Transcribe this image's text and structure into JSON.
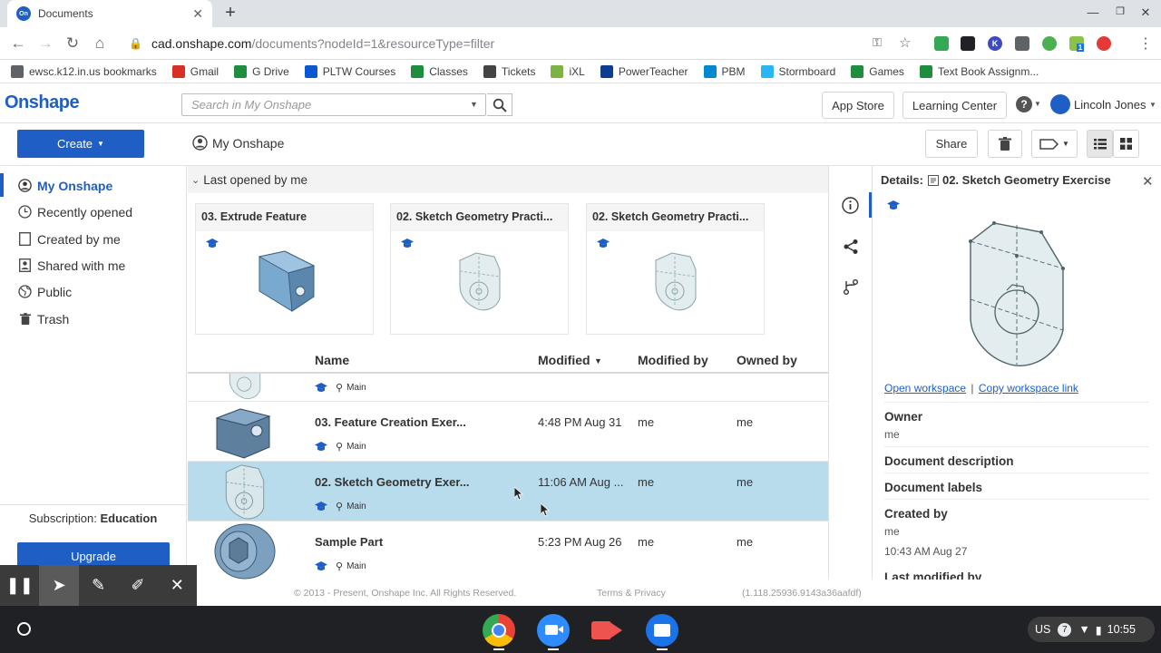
{
  "browser": {
    "tab_title": "Documents",
    "favicon_text": "On",
    "url_host": "cad.onshape.com",
    "url_path": "/documents?nodeId=1&resourceType=filter",
    "ext_badge": "1"
  },
  "bookmarks": [
    {
      "label": "ewsc.k12.in.us bookmarks",
      "color": "#5f6368"
    },
    {
      "label": "Gmail",
      "color": "#d93025"
    },
    {
      "label": "G Drive",
      "color": "#1e8e3e"
    },
    {
      "label": "PLTW Courses",
      "color": "#0b57d0"
    },
    {
      "label": "Classes",
      "color": "#1e8e3e"
    },
    {
      "label": "Tickets",
      "color": "#444444"
    },
    {
      "label": "iXL",
      "color": "#7cb342"
    },
    {
      "label": "PowerTeacher",
      "color": "#0b3d91"
    },
    {
      "label": "PBM",
      "color": "#0288d1"
    },
    {
      "label": "Stormboard",
      "color": "#29b6f6"
    },
    {
      "label": "Games",
      "color": "#1e8e3e"
    },
    {
      "label": "Text Book Assignm...",
      "color": "#1e8e3e"
    }
  ],
  "header": {
    "logo": "Onshape",
    "search_placeholder": "Search in My Onshape",
    "app_store": "App Store",
    "learning_center": "Learning Center",
    "user_name": "Lincoln Jones"
  },
  "toolbar": {
    "create": "Create",
    "title": "My Onshape",
    "share": "Share"
  },
  "sidebar": {
    "items": [
      {
        "label": "My Onshape"
      },
      {
        "label": "Recently opened"
      },
      {
        "label": "Created by me"
      },
      {
        "label": "Shared with me"
      },
      {
        "label": "Public"
      },
      {
        "label": "Trash"
      }
    ],
    "subscription_label": "Subscription:",
    "subscription_value": "Education",
    "upgrade": "Upgrade"
  },
  "recent": {
    "header": "Last opened by me",
    "cards": [
      {
        "title": "03. Extrude Feature"
      },
      {
        "title": "02. Sketch Geometry Practi..."
      },
      {
        "title": "02. Sketch Geometry Practi..."
      }
    ]
  },
  "table": {
    "headers": {
      "name": "Name",
      "modified": "Modified",
      "modified_by": "Modified by",
      "owned_by": "Owned by"
    },
    "branch_label": "Main",
    "rows": [
      {
        "name": "03. Feature Creation Exer...",
        "modified": "4:48 PM Aug 31",
        "modified_by": "me",
        "owned_by": "me"
      },
      {
        "name": "02. Sketch Geometry Exer...",
        "modified": "11:06 AM Aug ...",
        "modified_by": "me",
        "owned_by": "me"
      },
      {
        "name": "Sample Part",
        "modified": "5:23 PM Aug 26",
        "modified_by": "me",
        "owned_by": "me"
      }
    ]
  },
  "details": {
    "prefix": "Details:",
    "title": "02. Sketch Geometry Exercise",
    "open_workspace": "Open workspace",
    "separator": "|",
    "copy_link": "Copy workspace link",
    "owner_label": "Owner",
    "owner_value": "me",
    "description_label": "Document description",
    "labels_label": "Document labels",
    "created_by_label": "Created by",
    "created_by_value": "me",
    "created_date": "10:43 AM Aug 27",
    "last_modified_label": "Last modified by"
  },
  "footer": {
    "copyright": "© 2013 - Present, Onshape Inc. All Rights Reserved.",
    "terms": "Terms & Privacy",
    "version": "(1.118.25936.9143a36aafdf)"
  },
  "system_tray": {
    "ime": "US",
    "notifications": "7",
    "time": "10:55"
  },
  "colors": {
    "accent": "#1f5fc5",
    "selected_row": "#b9dcec"
  }
}
